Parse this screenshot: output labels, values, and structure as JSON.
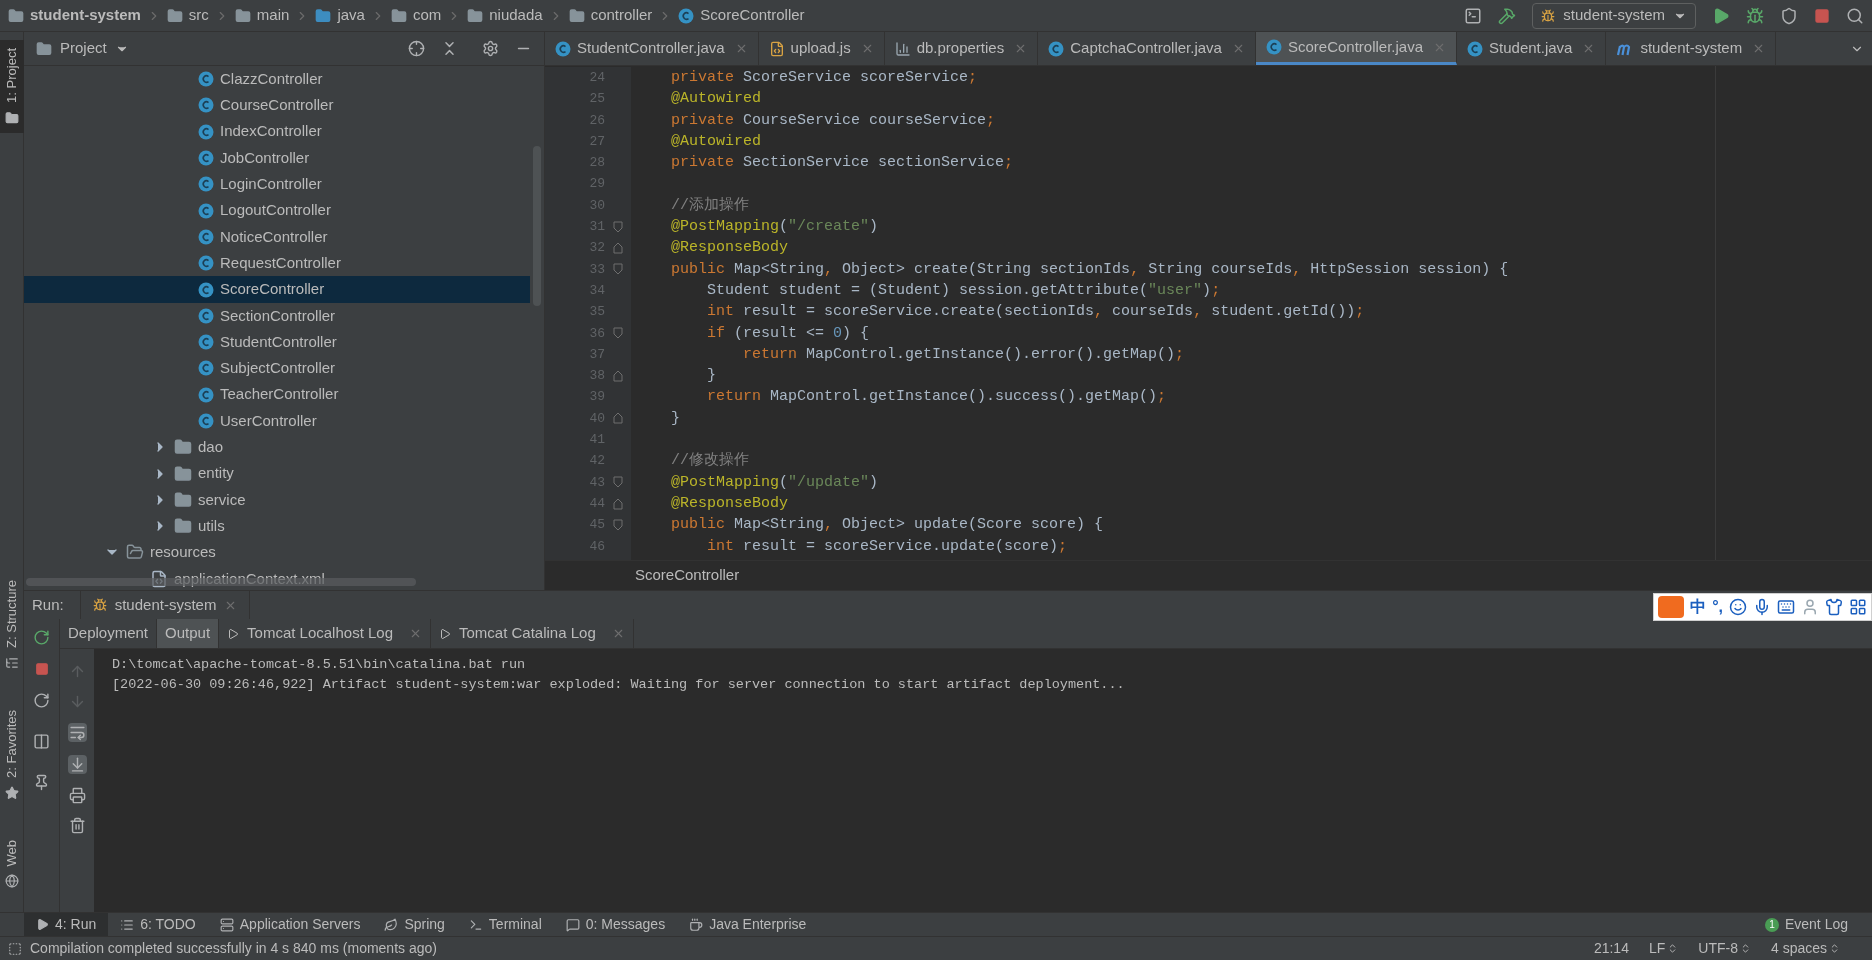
{
  "breadcrumbs": [
    {
      "kind": "module",
      "label": "student-system"
    },
    {
      "kind": "folder",
      "label": "src"
    },
    {
      "kind": "folder",
      "label": "main"
    },
    {
      "kind": "source",
      "label": "java"
    },
    {
      "kind": "package",
      "label": "com"
    },
    {
      "kind": "package",
      "label": "niudada"
    },
    {
      "kind": "package",
      "label": "controller"
    },
    {
      "kind": "class",
      "label": "ScoreController"
    }
  ],
  "run_config": "student-system",
  "left_stripe_top": [
    {
      "kind": "folder",
      "label": "1: Project",
      "selected": true
    }
  ],
  "left_stripe_bottom": [
    {
      "kind": "structure",
      "label": "Z: Structure",
      "selected": false
    },
    {
      "kind": "star",
      "label": "2: Favorites",
      "selected": false
    },
    {
      "kind": "globe",
      "label": "Web",
      "selected": false
    }
  ],
  "project_panel": {
    "title": "Project",
    "tree": [
      {
        "children": [
          {
            "children": [
              {
                "children": [
                  {
                    "kind": "class",
                    "label": "ClazzController",
                    "selected": false
                  },
                  {
                    "kind": "class",
                    "label": "CourseController",
                    "selected": false
                  },
                  {
                    "kind": "class",
                    "label": "IndexController",
                    "selected": false
                  },
                  {
                    "kind": "class",
                    "label": "JobController",
                    "selected": false
                  },
                  {
                    "kind": "class",
                    "label": "LoginController",
                    "selected": false
                  },
                  {
                    "kind": "class",
                    "label": "LogoutController",
                    "selected": false
                  },
                  {
                    "kind": "class",
                    "label": "NoticeController",
                    "selected": false
                  },
                  {
                    "kind": "class",
                    "label": "RequestController",
                    "selected": false
                  },
                  {
                    "kind": "class",
                    "label": "ScoreController",
                    "selected": true
                  },
                  {
                    "kind": "class",
                    "label": "SectionController",
                    "selected": false
                  },
                  {
                    "kind": "class",
                    "label": "StudentController",
                    "selected": false
                  },
                  {
                    "kind": "class",
                    "label": "SubjectController",
                    "selected": false
                  },
                  {
                    "kind": "class",
                    "label": "TeacherController",
                    "selected": false
                  },
                  {
                    "kind": "class",
                    "label": "UserController",
                    "selected": false
                  }
                ]
              },
              {
                "kind": "package",
                "label": "dao",
                "selected": false,
                "expanded": false
              },
              {
                "kind": "package",
                "label": "entity",
                "selected": false,
                "expanded": false
              },
              {
                "kind": "package",
                "label": "service",
                "selected": false,
                "expanded": false
              },
              {
                "kind": "package",
                "label": "utils",
                "selected": false,
                "expanded": false
              }
            ]
          }
        ]
      },
      {
        "kind": "resources",
        "label": "resources",
        "selected": false,
        "expanded": true,
        "children": [
          {
            "kind": "xml",
            "label": "applicationContext.xml",
            "selected": false
          }
        ]
      }
    ]
  },
  "editor": {
    "tabs": [
      {
        "kind": "class",
        "label": "StudentController.java",
        "selected": false
      },
      {
        "kind": "js",
        "label": "upload.js",
        "selected": false
      },
      {
        "kind": "properties",
        "label": "db.properties",
        "selected": false
      },
      {
        "kind": "class",
        "label": "CaptchaController.java",
        "selected": false
      },
      {
        "kind": "class",
        "label": "ScoreController.java",
        "selected": true
      },
      {
        "kind": "class",
        "label": "Student.java",
        "selected": false
      },
      {
        "kind": "maven",
        "label": "student-system",
        "selected": false
      }
    ],
    "lines": [
      {
        "number": "24",
        "fold_start": false,
        "fold_end": false,
        "tokens": [
          {
            "kind": "kw",
            "text": "    private "
          },
          {
            "kind": "plain",
            "text": "ScoreService scoreService"
          },
          {
            "kind": "kw",
            "text": ";"
          }
        ]
      },
      {
        "number": "25",
        "fold_start": false,
        "fold_end": false,
        "tokens": [
          {
            "kind": "ann",
            "text": "    @Autowired"
          }
        ]
      },
      {
        "number": "26",
        "fold_start": false,
        "fold_end": false,
        "tokens": [
          {
            "kind": "kw",
            "text": "    private "
          },
          {
            "kind": "plain",
            "text": "CourseService courseService"
          },
          {
            "kind": "kw",
            "text": ";"
          }
        ]
      },
      {
        "number": "27",
        "fold_start": false,
        "fold_end": false,
        "tokens": [
          {
            "kind": "ann",
            "text": "    @Autowired"
          }
        ]
      },
      {
        "number": "28",
        "fold_start": false,
        "fold_end": false,
        "tokens": [
          {
            "kind": "kw",
            "text": "    private "
          },
          {
            "kind": "plain",
            "text": "SectionService sectionService"
          },
          {
            "kind": "kw",
            "text": ";"
          }
        ]
      },
      {
        "number": "29",
        "fold_start": false,
        "fold_end": false
      },
      {
        "number": "30",
        "fold_start": false,
        "fold_end": false,
        "tokens": [
          {
            "kind": "cmt",
            "text": "    //添加操作"
          }
        ]
      },
      {
        "number": "31",
        "fold_start": true,
        "fold_end": false,
        "tokens": [
          {
            "kind": "ann",
            "text": "    @PostMapping"
          },
          {
            "kind": "plain",
            "text": "("
          },
          {
            "kind": "str",
            "text": "\"/create\""
          },
          {
            "kind": "plain",
            "text": ")"
          }
        ]
      },
      {
        "number": "32",
        "fold_start": false,
        "fold_end": true,
        "tokens": [
          {
            "kind": "ann",
            "text": "    @ResponseBody"
          }
        ]
      },
      {
        "number": "33",
        "fold_start": true,
        "fold_end": false,
        "tokens": [
          {
            "kind": "kw",
            "text": "    public "
          },
          {
            "kind": "plain",
            "text": "Map<String"
          },
          {
            "kind": "kw",
            "text": ","
          },
          {
            "kind": "plain",
            "text": " Object> create(String sectionIds"
          },
          {
            "kind": "kw",
            "text": ","
          },
          {
            "kind": "plain",
            "text": " String courseIds"
          },
          {
            "kind": "kw",
            "text": ","
          },
          {
            "kind": "plain",
            "text": " HttpSession session) {"
          }
        ]
      },
      {
        "number": "34",
        "fold_start": false,
        "fold_end": false,
        "tokens": [
          {
            "kind": "plain",
            "text": "        Student student = (Student) session.getAttribute("
          },
          {
            "kind": "str",
            "text": "\"user\""
          },
          {
            "kind": "plain",
            "text": ")"
          },
          {
            "kind": "kw",
            "text": ";"
          }
        ]
      },
      {
        "number": "35",
        "fold_start": false,
        "fold_end": false,
        "tokens": [
          {
            "kind": "kw",
            "text": "        int "
          },
          {
            "kind": "plain",
            "text": "result = scoreService.create(sectionIds"
          },
          {
            "kind": "kw",
            "text": ","
          },
          {
            "kind": "plain",
            "text": " courseIds"
          },
          {
            "kind": "kw",
            "text": ","
          },
          {
            "kind": "plain",
            "text": " student.getId())"
          },
          {
            "kind": "kw",
            "text": ";"
          }
        ]
      },
      {
        "number": "36",
        "fold_start": true,
        "fold_end": false,
        "tokens": [
          {
            "kind": "kw",
            "text": "        if "
          },
          {
            "kind": "plain",
            "text": "(result <= "
          },
          {
            "kind": "num",
            "text": "0"
          },
          {
            "kind": "plain",
            "text": ") {"
          }
        ]
      },
      {
        "number": "37",
        "fold_start": false,
        "fold_end": false,
        "tokens": [
          {
            "kind": "kw",
            "text": "            return "
          },
          {
            "kind": "plain",
            "text": "MapControl.getInstance().error().getMap()"
          },
          {
            "kind": "kw",
            "text": ";"
          }
        ]
      },
      {
        "number": "38",
        "fold_start": false,
        "fold_end": true,
        "tokens": [
          {
            "kind": "plain",
            "text": "        }"
          }
        ]
      },
      {
        "number": "39",
        "fold_start": false,
        "fold_end": false,
        "tokens": [
          {
            "kind": "kw",
            "text": "        return "
          },
          {
            "kind": "plain",
            "text": "MapControl.getInstance().success().getMap()"
          },
          {
            "kind": "kw",
            "text": ";"
          }
        ]
      },
      {
        "number": "40",
        "fold_start": false,
        "fold_end": true,
        "tokens": [
          {
            "kind": "plain",
            "text": "    }"
          }
        ]
      },
      {
        "number": "41",
        "fold_start": false,
        "fold_end": false
      },
      {
        "number": "42",
        "fold_start": false,
        "fold_end": false,
        "tokens": [
          {
            "kind": "cmt",
            "text": "    //修改操作"
          }
        ]
      },
      {
        "number": "43",
        "fold_start": true,
        "fold_end": false,
        "tokens": [
          {
            "kind": "ann",
            "text": "    @PostMapping"
          },
          {
            "kind": "plain",
            "text": "("
          },
          {
            "kind": "str",
            "text": "\"/update\""
          },
          {
            "kind": "plain",
            "text": ")"
          }
        ]
      },
      {
        "number": "44",
        "fold_start": false,
        "fold_end": true,
        "tokens": [
          {
            "kind": "ann",
            "text": "    @ResponseBody"
          }
        ]
      },
      {
        "number": "45",
        "fold_start": true,
        "fold_end": false,
        "tokens": [
          {
            "kind": "kw",
            "text": "    public "
          },
          {
            "kind": "plain",
            "text": "Map<String"
          },
          {
            "kind": "kw",
            "text": ","
          },
          {
            "kind": "plain",
            "text": " Object> update(Score score) {"
          }
        ]
      },
      {
        "number": "46",
        "fold_start": false,
        "fold_end": false,
        "tokens": [
          {
            "kind": "kw",
            "text": "        int "
          },
          {
            "kind": "plain",
            "text": "result = scoreService.update(score)"
          },
          {
            "kind": "kw",
            "text": ";"
          }
        ]
      }
    ],
    "breadcrumb": "ScoreController"
  },
  "run": {
    "title": "Run:",
    "session": "student-system",
    "tabs": [
      {
        "kind": "plain",
        "label": "Deployment",
        "selected": false
      },
      {
        "kind": "plain",
        "label": "Output",
        "selected": true
      },
      {
        "kind": "log",
        "label": "Tomcat Localhost Log",
        "selected": false
      },
      {
        "kind": "log",
        "label": "Tomcat Catalina Log",
        "selected": false
      }
    ],
    "console": [
      "D:\\tomcat\\apache-tomcat-8.5.51\\bin\\catalina.bat run",
      "[2022-06-30 09:26:46,922] Artifact student-system:war exploded: Waiting for server connection to start artifact deployment..."
    ]
  },
  "ime": {
    "labels": [
      "中",
      "°,"
    ]
  },
  "tool_tabs": [
    {
      "kind": "run",
      "label": "4: Run",
      "selected": true
    },
    {
      "kind": "todo",
      "label": "6: TODO",
      "selected": false
    },
    {
      "kind": "server",
      "label": "Application Servers",
      "selected": false
    },
    {
      "kind": "spring",
      "label": "Spring",
      "selected": false
    },
    {
      "kind": "terminal",
      "label": "Terminal",
      "selected": false
    },
    {
      "kind": "messages",
      "label": "0: Messages",
      "selected": false
    },
    {
      "kind": "enterprise",
      "label": "Java Enterprise",
      "selected": false
    }
  ],
  "event_log": {
    "count": "1",
    "label": "Event Log"
  },
  "status": {
    "message": "Compilation completed successfully in 4 s 840 ms (moments ago)",
    "items": [
      {
        "text": "21:14",
        "dropdown": false
      },
      {
        "text": "LF",
        "dropdown": true
      },
      {
        "text": "UTF-8",
        "dropdown": true
      },
      {
        "text": "4 spaces",
        "dropdown": true
      }
    ]
  }
}
